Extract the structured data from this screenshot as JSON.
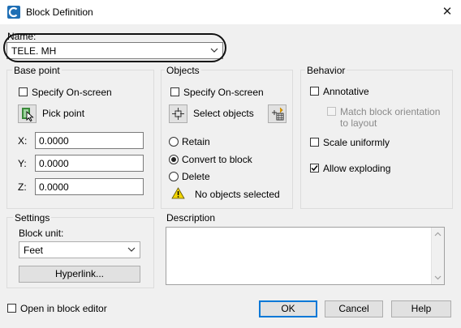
{
  "window": {
    "title": "Block Definition",
    "close_glyph": "✕"
  },
  "name": {
    "label": "Name:",
    "value": "TELE. MH"
  },
  "base_point": {
    "group_label": "Base point",
    "specify_onscreen": {
      "label": "Specify On-screen",
      "checked": false
    },
    "pick_point_label": "Pick point",
    "x": {
      "label": "X:",
      "value": "0.0000"
    },
    "y": {
      "label": "Y:",
      "value": "0.0000"
    },
    "z": {
      "label": "Z:",
      "value": "0.0000"
    }
  },
  "objects": {
    "group_label": "Objects",
    "specify_onscreen": {
      "label": "Specify On-screen",
      "checked": false
    },
    "select_objects_label": "Select objects",
    "options": [
      {
        "label": "Retain",
        "selected": false
      },
      {
        "label": "Convert to block",
        "selected": true
      },
      {
        "label": "Delete",
        "selected": false
      }
    ],
    "status": "No objects selected"
  },
  "behavior": {
    "group_label": "Behavior",
    "annotative": {
      "label": "Annotative",
      "checked": false
    },
    "match_orientation": {
      "label_line1": "Match block orientation",
      "label_line2": "to layout",
      "checked": false,
      "disabled": true
    },
    "scale_uniformly": {
      "label": "Scale uniformly",
      "checked": false
    },
    "allow_exploding": {
      "label": "Allow exploding",
      "checked": true
    }
  },
  "settings": {
    "group_label": "Settings",
    "block_unit_label": "Block unit:",
    "block_unit_value": "Feet",
    "hyperlink_label": "Hyperlink..."
  },
  "description": {
    "label": "Description",
    "value": ""
  },
  "footer": {
    "open_in_editor": {
      "label": "Open in block editor",
      "checked": false
    },
    "ok_label": "OK",
    "cancel_label": "Cancel",
    "help_label": "Help"
  },
  "colors": {
    "accent": "#0078d7",
    "warning": "#f2d500",
    "background": "#f0f0f0"
  }
}
